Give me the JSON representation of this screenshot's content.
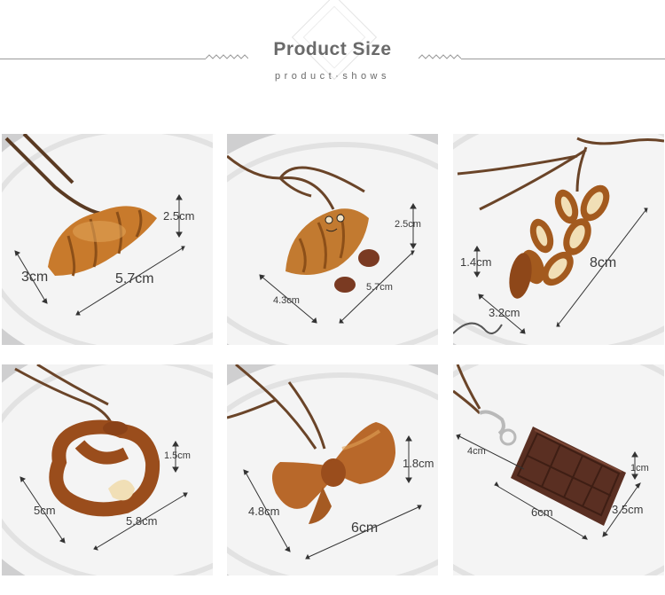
{
  "header": {
    "title": "Product Size",
    "subtitle": "product·shows"
  },
  "products": [
    {
      "name": "croissant",
      "measures": [
        "2.5cm",
        "3cm",
        "5.7cm"
      ]
    },
    {
      "name": "croissant-with-face",
      "measures": [
        "2.5cm",
        "4.3cm",
        "5.7cm"
      ]
    },
    {
      "name": "wheat-ear",
      "measures": [
        "1.4cm",
        "3.2cm",
        "8cm"
      ]
    },
    {
      "name": "pretzel",
      "measures": [
        "1.5cm",
        "5cm",
        "5.8cm"
      ]
    },
    {
      "name": "bow",
      "measures": [
        "1.8cm",
        "4.8cm",
        "6cm"
      ]
    },
    {
      "name": "chocolate-bar",
      "measures": [
        "4cm",
        "1cm",
        "6cm",
        "3.5cm"
      ]
    }
  ]
}
